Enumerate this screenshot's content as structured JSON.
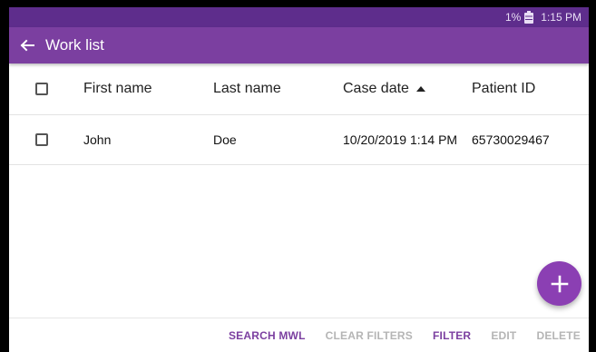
{
  "status_bar": {
    "battery_percent": "1%",
    "time": "1:15 PM"
  },
  "app_bar": {
    "title": "Work list"
  },
  "table": {
    "headers": {
      "first_name": "First name",
      "last_name": "Last name",
      "case_date": "Case date",
      "patient_id": "Patient ID"
    },
    "sort": {
      "column": "case_date",
      "direction": "ascending"
    },
    "rows": [
      {
        "first_name": "John",
        "last_name": "Doe",
        "case_date": "10/20/2019 1:14 PM",
        "patient_id": "65730029467"
      }
    ]
  },
  "actions": {
    "search_mwl": "SEARCH MWL",
    "clear_filters": "CLEAR FILTERS",
    "filter": "FILTER",
    "edit": "EDIT",
    "delete": "DELETE"
  },
  "icons": {
    "back": "arrow-left-icon",
    "battery": "battery-icon",
    "sort": "sort-up-icon",
    "fab": "plus-icon"
  },
  "colors": {
    "status_bar": "#5e2d8c",
    "app_bar": "#7b3fa0",
    "fab": "#8b3fb3",
    "action_active": "#7b3fa0",
    "action_disabled": "#b5b5b5"
  }
}
